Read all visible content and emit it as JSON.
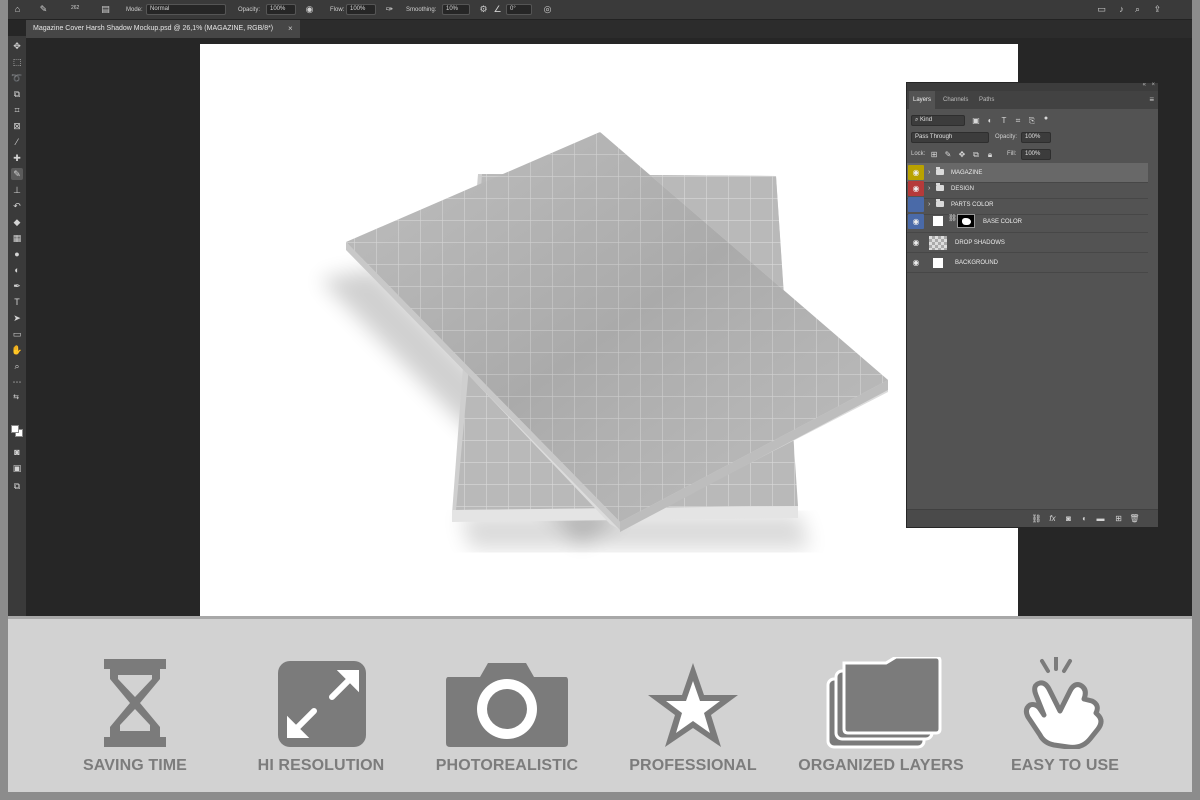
{
  "options_bar": {
    "brush_size": "262",
    "mode_label": "Mode:",
    "mode_value": "Normal",
    "opacity_label": "Opacity:",
    "opacity_value": "100%",
    "flow_label": "Flow:",
    "flow_value": "100%",
    "smoothing_label": "Smoothing:",
    "smoothing_value": "10%",
    "angle_value": "0°"
  },
  "document": {
    "tab_title": "Magazine Cover Harsh Shadow Mockup.psd @ 26,1% (MAGAZINE, RGB/8*)",
    "close_glyph": "×"
  },
  "layers_panel": {
    "tabs": [
      "Layers",
      "Channels",
      "Paths"
    ],
    "active_tab": "Layers",
    "filter_kind": "Kind",
    "blend_mode": "Pass Through",
    "opacity_label": "Opacity:",
    "opacity_value": "100%",
    "lock_label": "Lock:",
    "fill_label": "Fill:",
    "fill_value": "100%",
    "layers": [
      {
        "name": "MAGAZINE",
        "type": "group",
        "label_color": "#b9a200",
        "visible": true,
        "selected": true
      },
      {
        "name": "DESIGN",
        "type": "group",
        "label_color": "#b53a3a",
        "visible": true,
        "selected": false
      },
      {
        "name": "PARTS COLOR",
        "type": "group",
        "label_color": "#4a6aa8",
        "visible": false,
        "selected": false
      },
      {
        "name": "BASE COLOR",
        "type": "masked",
        "label_color": "#4a6aa8",
        "visible": true,
        "selected": false
      },
      {
        "name": "DROP SHADOWS",
        "type": "transparent",
        "label_color": null,
        "visible": true,
        "selected": false
      },
      {
        "name": "BACKGROUND",
        "type": "white",
        "label_color": null,
        "visible": true,
        "selected": false
      }
    ],
    "bottom_icons": [
      "link-icon",
      "fx-icon",
      "mask-icon",
      "adjustment-icon",
      "folder-icon",
      "new-layer-icon",
      "trash-icon"
    ],
    "fx_label": "fx"
  },
  "features": [
    {
      "label": "SAVING TIME",
      "icon": "hourglass-icon"
    },
    {
      "label": "HI RESOLUTION",
      "icon": "expand-icon"
    },
    {
      "label": "PHOTOREALISTIC",
      "icon": "camera-icon"
    },
    {
      "label": "PROFESSIONAL",
      "icon": "star-icon"
    },
    {
      "label": "ORGANIZED LAYERS",
      "icon": "layers-folder-icon"
    },
    {
      "label": "EASY TO USE",
      "icon": "hand-tap-icon"
    }
  ],
  "colors": {
    "feature_icon": "#7b7b7b",
    "feature_bg": "#d2d2d2",
    "panel_bg": "#535353",
    "app_bg": "#262626"
  }
}
